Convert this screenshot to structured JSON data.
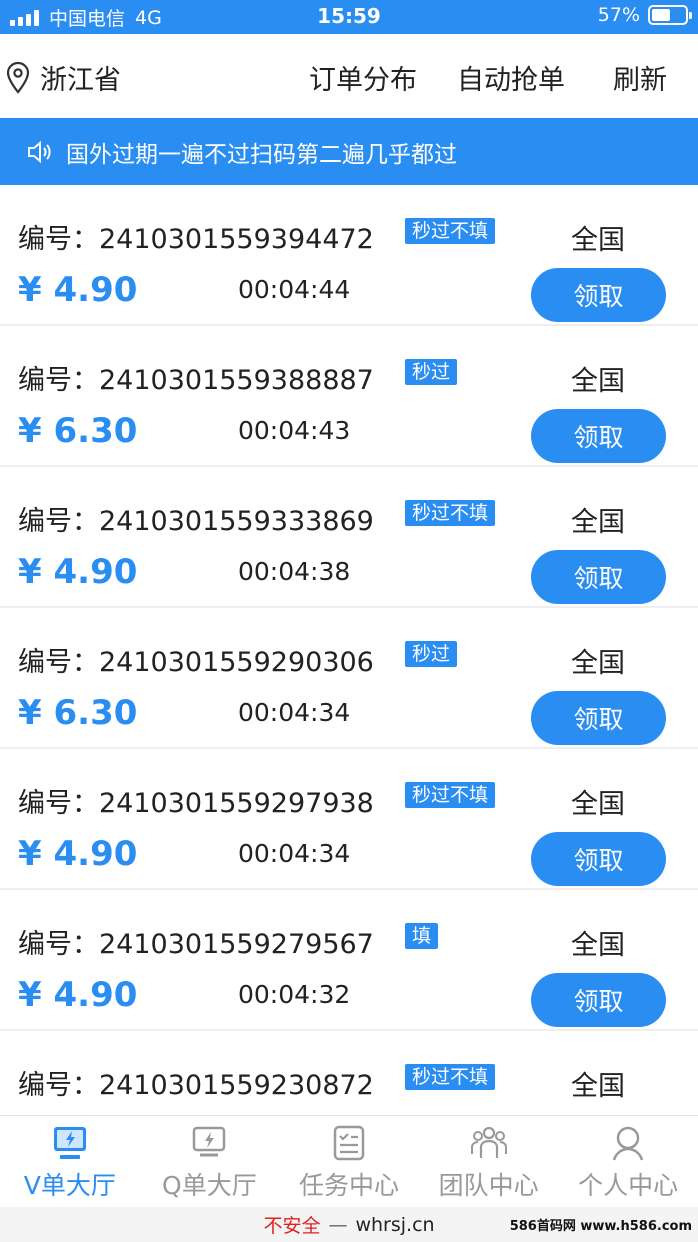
{
  "status_bar": {
    "carrier": "中国电信",
    "network": "4G",
    "time": "15:59",
    "battery": "57%",
    "battery_level": 0.57
  },
  "header": {
    "location": "浙江省",
    "nav": [
      "订单分布",
      "自动抢单",
      "刷新"
    ]
  },
  "notice": {
    "text": "国外过期一遍不过扫码第二遍几乎都过"
  },
  "orders": [
    {
      "label": "编号：",
      "number": "2410301559394472",
      "tag": "秒过不填",
      "region": "全国",
      "price": "¥ 4.90",
      "time": "00:04:44",
      "button": "领取"
    },
    {
      "label": "编号：",
      "number": "2410301559388887",
      "tag": "秒过",
      "region": "全国",
      "price": "¥ 6.30",
      "time": "00:04:43",
      "button": "领取"
    },
    {
      "label": "编号：",
      "number": "2410301559333869",
      "tag": "秒过不填",
      "region": "全国",
      "price": "¥ 4.90",
      "time": "00:04:38",
      "button": "领取"
    },
    {
      "label": "编号：",
      "number": "2410301559290306",
      "tag": "秒过",
      "region": "全国",
      "price": "¥ 6.30",
      "time": "00:04:34",
      "button": "领取"
    },
    {
      "label": "编号：",
      "number": "2410301559297938",
      "tag": "秒过不填",
      "region": "全国",
      "price": "¥ 4.90",
      "time": "00:04:34",
      "button": "领取"
    },
    {
      "label": "编号：",
      "number": "2410301559279567",
      "tag": "填",
      "region": "全国",
      "price": "¥ 4.90",
      "time": "00:04:32",
      "button": "领取"
    },
    {
      "label": "编号：",
      "number": "2410301559230872",
      "tag": "秒过不填",
      "region": "全国",
      "price": "",
      "time": "",
      "button": ""
    }
  ],
  "tabs": [
    {
      "label": "V单大厅",
      "icon": "monitor-bolt-icon",
      "active": true
    },
    {
      "label": "Q单大厅",
      "icon": "monitor-bolt-icon",
      "active": false
    },
    {
      "label": "任务中心",
      "icon": "checklist-icon",
      "active": false
    },
    {
      "label": "团队中心",
      "icon": "team-icon",
      "active": false
    },
    {
      "label": "个人中心",
      "icon": "user-icon",
      "active": false
    }
  ],
  "browser": {
    "security": "不安全",
    "separator": "—",
    "domain": "whrsj.cn"
  },
  "watermark": "586首码网 www.h586.com",
  "colors": {
    "accent": "#2a8df2",
    "warning": "#e02020",
    "inactive": "#999999"
  }
}
